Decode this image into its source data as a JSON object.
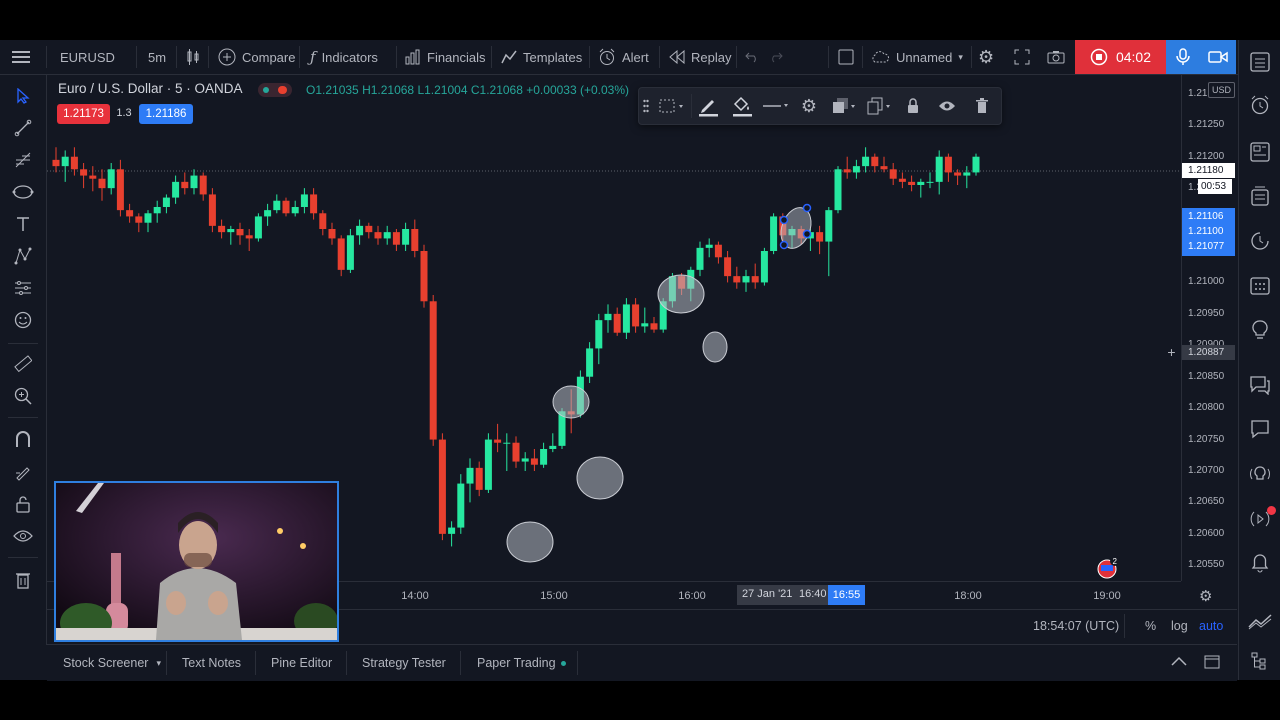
{
  "header": {
    "symbol": "EURUSD",
    "interval": "5m",
    "compare_label": "Compare",
    "indicators_label": "Indicators",
    "financials_label": "Financials",
    "templates_label": "Templates",
    "alert_label": "Alert",
    "replay_label": "Replay",
    "layout_name": "Unnamed",
    "record_timer": "04:02"
  },
  "legend": {
    "title": "Euro / U.S. Dollar · 5 · OANDA",
    "open": "O1.21035",
    "high": "H1.21068",
    "low": "L1.21004",
    "close": "C1.21068",
    "change": "+0.00033 (+0.03%)",
    "sell_price": "1.21173",
    "spread": "1.3",
    "buy_price": "1.21186"
  },
  "price_axis": {
    "currency": "USD",
    "ticks": [
      "1.21300",
      "1.21250",
      "1.21200",
      "1.21150",
      "1.21000",
      "1.20950",
      "1.20900",
      "1.20850",
      "1.20800",
      "1.20750",
      "1.20700",
      "1.20650",
      "1.20600",
      "1.20550"
    ],
    "last_price": "1.21180",
    "countdown": "00:53",
    "partial_tag": "1.",
    "blue_tags": [
      "1.21106",
      "1.21100",
      "1.21077"
    ],
    "crosshair_price": "1.20887"
  },
  "time_axis": {
    "ticks": [
      "14:00",
      "15:00",
      "16:00",
      "18:00",
      "19:00"
    ],
    "highlight_date": "27 Jan '21",
    "highlight_from": "16:40",
    "highlight_to": "16:55"
  },
  "bottom_info": {
    "clock": "18:54:07 (UTC)",
    "percent": "%",
    "log": "log",
    "auto": "auto"
  },
  "bottom_tabs": [
    "Stock Screener",
    "Text Notes",
    "Pine Editor",
    "Strategy Tester",
    "Paper Trading"
  ],
  "colors": {
    "bull": "#26e8a0",
    "bear": "#e8402f",
    "accent": "#2962ff",
    "record": "#e0303a"
  },
  "chart_data": {
    "type": "candlestick",
    "interval": "5m",
    "candles": [
      {
        "o": 1.21195,
        "h": 1.21215,
        "l": 1.21175,
        "c": 1.21185
      },
      {
        "o": 1.21185,
        "h": 1.2121,
        "l": 1.2116,
        "c": 1.212
      },
      {
        "o": 1.212,
        "h": 1.21215,
        "l": 1.2117,
        "c": 1.2118
      },
      {
        "o": 1.2118,
        "h": 1.2119,
        "l": 1.2115,
        "c": 1.2117
      },
      {
        "o": 1.2117,
        "h": 1.21185,
        "l": 1.21145,
        "c": 1.21165
      },
      {
        "o": 1.21165,
        "h": 1.2118,
        "l": 1.2113,
        "c": 1.2115
      },
      {
        "o": 1.2115,
        "h": 1.2119,
        "l": 1.2114,
        "c": 1.2118
      },
      {
        "o": 1.2118,
        "h": 1.21195,
        "l": 1.21105,
        "c": 1.21115
      },
      {
        "o": 1.21115,
        "h": 1.21125,
        "l": 1.21095,
        "c": 1.21105
      },
      {
        "o": 1.21105,
        "h": 1.2111,
        "l": 1.2108,
        "c": 1.21095
      },
      {
        "o": 1.21095,
        "h": 1.21115,
        "l": 1.2108,
        "c": 1.2111
      },
      {
        "o": 1.2111,
        "h": 1.2113,
        "l": 1.21095,
        "c": 1.2112
      },
      {
        "o": 1.2112,
        "h": 1.2114,
        "l": 1.2111,
        "c": 1.21135
      },
      {
        "o": 1.21135,
        "h": 1.2117,
        "l": 1.21125,
        "c": 1.2116
      },
      {
        "o": 1.2116,
        "h": 1.21175,
        "l": 1.2114,
        "c": 1.2115
      },
      {
        "o": 1.2115,
        "h": 1.2118,
        "l": 1.2114,
        "c": 1.2117
      },
      {
        "o": 1.2117,
        "h": 1.21175,
        "l": 1.2113,
        "c": 1.2114
      },
      {
        "o": 1.2114,
        "h": 1.2115,
        "l": 1.2108,
        "c": 1.2109
      },
      {
        "o": 1.2109,
        "h": 1.211,
        "l": 1.2107,
        "c": 1.2108
      },
      {
        "o": 1.2108,
        "h": 1.2109,
        "l": 1.2106,
        "c": 1.21085
      },
      {
        "o": 1.21085,
        "h": 1.21095,
        "l": 1.2106,
        "c": 1.21075
      },
      {
        "o": 1.21075,
        "h": 1.21085,
        "l": 1.2105,
        "c": 1.2107
      },
      {
        "o": 1.2107,
        "h": 1.2111,
        "l": 1.21065,
        "c": 1.21105
      },
      {
        "o": 1.21105,
        "h": 1.21125,
        "l": 1.2109,
        "c": 1.21115
      },
      {
        "o": 1.21115,
        "h": 1.2114,
        "l": 1.2111,
        "c": 1.2113
      },
      {
        "o": 1.2113,
        "h": 1.21135,
        "l": 1.21105,
        "c": 1.2111
      },
      {
        "o": 1.2111,
        "h": 1.2113,
        "l": 1.21105,
        "c": 1.2112
      },
      {
        "o": 1.2112,
        "h": 1.2115,
        "l": 1.2111,
        "c": 1.2114
      },
      {
        "o": 1.2114,
        "h": 1.2115,
        "l": 1.211,
        "c": 1.2111
      },
      {
        "o": 1.2111,
        "h": 1.21115,
        "l": 1.21075,
        "c": 1.21085
      },
      {
        "o": 1.21085,
        "h": 1.21095,
        "l": 1.2106,
        "c": 1.2107
      },
      {
        "o": 1.2107,
        "h": 1.21075,
        "l": 1.2101,
        "c": 1.2102
      },
      {
        "o": 1.2102,
        "h": 1.21085,
        "l": 1.21015,
        "c": 1.21075
      },
      {
        "o": 1.21075,
        "h": 1.211,
        "l": 1.2106,
        "c": 1.2109
      },
      {
        "o": 1.2109,
        "h": 1.21095,
        "l": 1.2107,
        "c": 1.2108
      },
      {
        "o": 1.2108,
        "h": 1.2109,
        "l": 1.2106,
        "c": 1.2107
      },
      {
        "o": 1.2107,
        "h": 1.2109,
        "l": 1.2106,
        "c": 1.2108
      },
      {
        "o": 1.2108,
        "h": 1.21085,
        "l": 1.2105,
        "c": 1.2106
      },
      {
        "o": 1.2106,
        "h": 1.21095,
        "l": 1.2105,
        "c": 1.21085
      },
      {
        "o": 1.21085,
        "h": 1.211,
        "l": 1.2104,
        "c": 1.2105
      },
      {
        "o": 1.2105,
        "h": 1.2106,
        "l": 1.2096,
        "c": 1.2097
      },
      {
        "o": 1.2097,
        "h": 1.2098,
        "l": 1.2074,
        "c": 1.2075
      },
      {
        "o": 1.2075,
        "h": 1.2076,
        "l": 1.2059,
        "c": 1.206
      },
      {
        "o": 1.206,
        "h": 1.2062,
        "l": 1.2058,
        "c": 1.2061
      },
      {
        "o": 1.2061,
        "h": 1.20695,
        "l": 1.206,
        "c": 1.2068
      },
      {
        "o": 1.2068,
        "h": 1.2072,
        "l": 1.2065,
        "c": 1.20705
      },
      {
        "o": 1.20705,
        "h": 1.20715,
        "l": 1.2066,
        "c": 1.2067
      },
      {
        "o": 1.2067,
        "h": 1.2076,
        "l": 1.20665,
        "c": 1.2075
      },
      {
        "o": 1.2075,
        "h": 1.20775,
        "l": 1.2073,
        "c": 1.20745
      },
      {
        "o": 1.20745,
        "h": 1.2076,
        "l": 1.207,
        "c": 1.20745
      },
      {
        "o": 1.20745,
        "h": 1.20755,
        "l": 1.20705,
        "c": 1.20715
      },
      {
        "o": 1.20715,
        "h": 1.2073,
        "l": 1.207,
        "c": 1.2072
      },
      {
        "o": 1.2072,
        "h": 1.20735,
        "l": 1.207,
        "c": 1.2071
      },
      {
        "o": 1.2071,
        "h": 1.20745,
        "l": 1.20705,
        "c": 1.20735
      },
      {
        "o": 1.20735,
        "h": 1.2076,
        "l": 1.2073,
        "c": 1.2074
      },
      {
        "o": 1.2074,
        "h": 1.208,
        "l": 1.20735,
        "c": 1.20795
      },
      {
        "o": 1.20795,
        "h": 1.2083,
        "l": 1.2076,
        "c": 1.2079
      },
      {
        "o": 1.2079,
        "h": 1.2086,
        "l": 1.20785,
        "c": 1.2085
      },
      {
        "o": 1.2085,
        "h": 1.20905,
        "l": 1.2084,
        "c": 1.20895
      },
      {
        "o": 1.20895,
        "h": 1.2095,
        "l": 1.2087,
        "c": 1.2094
      },
      {
        "o": 1.2094,
        "h": 1.20965,
        "l": 1.2092,
        "c": 1.2095
      },
      {
        "o": 1.2095,
        "h": 1.2096,
        "l": 1.20915,
        "c": 1.2092
      },
      {
        "o": 1.2092,
        "h": 1.20975,
        "l": 1.2091,
        "c": 1.20965
      },
      {
        "o": 1.20965,
        "h": 1.20975,
        "l": 1.2092,
        "c": 1.2093
      },
      {
        "o": 1.2093,
        "h": 1.2096,
        "l": 1.2092,
        "c": 1.20935
      },
      {
        "o": 1.20935,
        "h": 1.20945,
        "l": 1.2092,
        "c": 1.20925
      },
      {
        "o": 1.20925,
        "h": 1.20975,
        "l": 1.2092,
        "c": 1.2097
      },
      {
        "o": 1.2097,
        "h": 1.21015,
        "l": 1.2096,
        "c": 1.2101
      },
      {
        "o": 1.2101,
        "h": 1.21015,
        "l": 1.2098,
        "c": 1.2099
      },
      {
        "o": 1.2099,
        "h": 1.21025,
        "l": 1.2097,
        "c": 1.2102
      },
      {
        "o": 1.2102,
        "h": 1.21065,
        "l": 1.2101,
        "c": 1.21055
      },
      {
        "o": 1.21055,
        "h": 1.2107,
        "l": 1.2104,
        "c": 1.2106
      },
      {
        "o": 1.2106,
        "h": 1.21065,
        "l": 1.2103,
        "c": 1.2104
      },
      {
        "o": 1.2104,
        "h": 1.2105,
        "l": 1.21,
        "c": 1.2101
      },
      {
        "o": 1.2101,
        "h": 1.21025,
        "l": 1.2099,
        "c": 1.21
      },
      {
        "o": 1.21,
        "h": 1.2102,
        "l": 1.20985,
        "c": 1.2101
      },
      {
        "o": 1.2101,
        "h": 1.2103,
        "l": 1.2099,
        "c": 1.21
      },
      {
        "o": 1.21,
        "h": 1.21055,
        "l": 1.20995,
        "c": 1.2105
      },
      {
        "o": 1.2105,
        "h": 1.2111,
        "l": 1.21045,
        "c": 1.21105
      },
      {
        "o": 1.21105,
        "h": 1.2111,
        "l": 1.2106,
        "c": 1.21075
      },
      {
        "o": 1.21075,
        "h": 1.2109,
        "l": 1.21055,
        "c": 1.21085
      },
      {
        "o": 1.21085,
        "h": 1.2109,
        "l": 1.2106,
        "c": 1.2107
      },
      {
        "o": 1.2107,
        "h": 1.21085,
        "l": 1.2105,
        "c": 1.2108
      },
      {
        "o": 1.2108,
        "h": 1.2109,
        "l": 1.21045,
        "c": 1.21065
      },
      {
        "o": 1.21065,
        "h": 1.2112,
        "l": 1.2101,
        "c": 1.21115
      },
      {
        "o": 1.21115,
        "h": 1.21185,
        "l": 1.2111,
        "c": 1.2118
      },
      {
        "o": 1.2118,
        "h": 1.212,
        "l": 1.21165,
        "c": 1.21175
      },
      {
        "o": 1.21175,
        "h": 1.21195,
        "l": 1.21165,
        "c": 1.21185
      },
      {
        "o": 1.21185,
        "h": 1.21215,
        "l": 1.21175,
        "c": 1.212
      },
      {
        "o": 1.212,
        "h": 1.21205,
        "l": 1.21175,
        "c": 1.21185
      },
      {
        "o": 1.21185,
        "h": 1.212,
        "l": 1.21175,
        "c": 1.2118
      },
      {
        "o": 1.2118,
        "h": 1.2119,
        "l": 1.21155,
        "c": 1.21165
      },
      {
        "o": 1.21165,
        "h": 1.21175,
        "l": 1.2115,
        "c": 1.2116
      },
      {
        "o": 1.2116,
        "h": 1.2117,
        "l": 1.21145,
        "c": 1.21155
      },
      {
        "o": 1.21155,
        "h": 1.21165,
        "l": 1.21135,
        "c": 1.2116
      },
      {
        "o": 1.2116,
        "h": 1.21175,
        "l": 1.2115,
        "c": 1.2116
      },
      {
        "o": 1.2116,
        "h": 1.2121,
        "l": 1.2114,
        "c": 1.212
      },
      {
        "o": 1.212,
        "h": 1.21205,
        "l": 1.2116,
        "c": 1.21175
      },
      {
        "o": 1.21175,
        "h": 1.2118,
        "l": 1.21155,
        "c": 1.2117
      },
      {
        "o": 1.2117,
        "h": 1.21185,
        "l": 1.2115,
        "c": 1.21175
      },
      {
        "o": 1.21175,
        "h": 1.21205,
        "l": 1.2117,
        "c": 1.212
      }
    ],
    "ylim": [
      1.20525,
      1.2133
    ]
  }
}
